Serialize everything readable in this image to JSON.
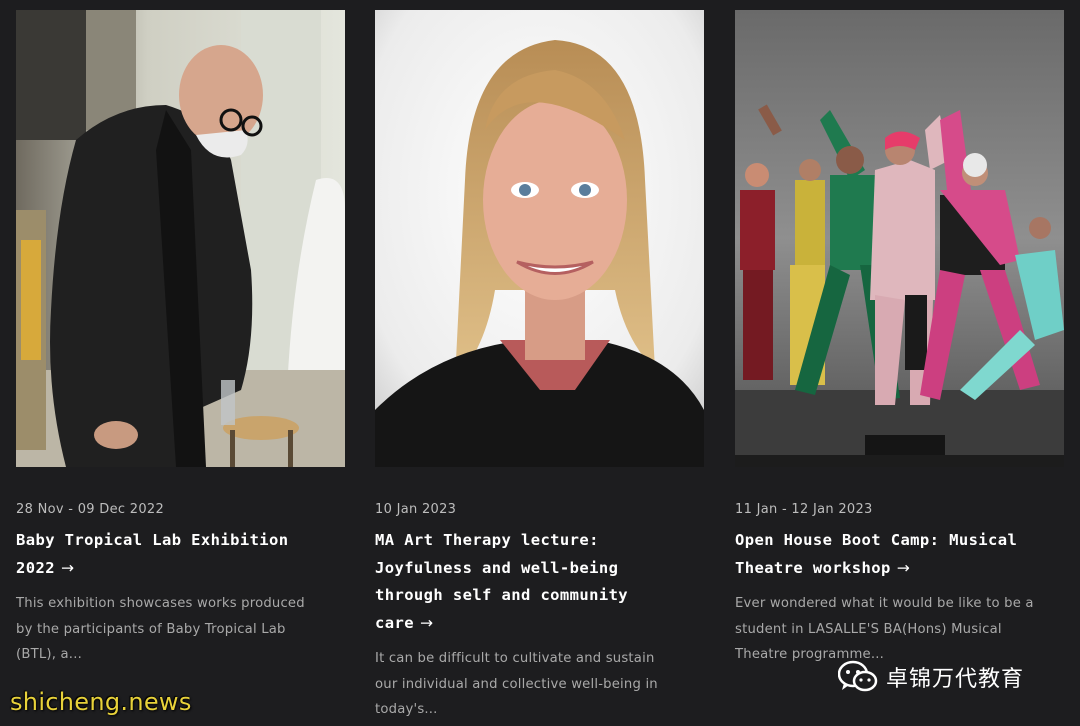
{
  "cards": [
    {
      "image_desc": "bald-man-with-glasses-photo",
      "date": "28 Nov - 09 Dec 2022",
      "title_lines": [
        "Baby Tropical Lab Exhibition",
        "2022"
      ],
      "arrow": "→",
      "desc_lines": [
        "This exhibition showcases works produced",
        "by the participants of Baby Tropical Lab",
        "(BTL), a..."
      ]
    },
    {
      "image_desc": "blonde-woman-portrait-photo",
      "date": "10 Jan 2023",
      "title_lines": [
        "MA Art Therapy lecture:",
        "Joyfulness and well-being",
        "through self and community",
        "care"
      ],
      "arrow": "→",
      "desc_lines": [
        "It can be difficult to cultivate and sustain",
        "our individual and collective well-being in",
        "today's..."
      ]
    },
    {
      "image_desc": "dancers-on-stage-photo",
      "date": "11 Jan - 12 Jan 2023",
      "title_lines": [
        "Open House Boot Camp: Musical",
        "Theatre workshop"
      ],
      "arrow": "→",
      "desc_lines": [
        "Ever wondered what it would be like to be a",
        "student in LASALLE'S BA(Hons) Musical",
        "Theatre programme..."
      ]
    }
  ],
  "watermarks": {
    "left": "shicheng.news",
    "right": "卓锦万代教育",
    "left_color": "#e8d23a"
  },
  "colors": {
    "background": "#1d1d1f",
    "title": "#ffffff",
    "date": "#bdbdbd",
    "desc": "#a9a9a9"
  }
}
